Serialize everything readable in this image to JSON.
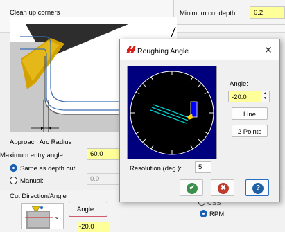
{
  "background_dialog": {
    "clean_up_corners_label": "Clean up corners",
    "minimum_cut_depth_label": "Minimum cut depth:",
    "minimum_cut_depth_value": "0.2",
    "approach_arc_title": "Approach Arc Radius",
    "max_entry_angle_label": "Maximum entry angle:",
    "max_entry_angle_value": "60.0",
    "same_as_depth_label": "Same as depth cut",
    "manual_label": "Manual:",
    "manual_value": "0.0",
    "cut_direction_title": "Cut Direction/Angle",
    "angle_button_label": "Angle...",
    "angle_value": "-20.0",
    "css_label": "CSS",
    "rpm_label": "RPM"
  },
  "roughing_angle_dialog": {
    "title": "Roughing Angle",
    "close_glyph": "✕",
    "angle_label": "Angle:",
    "angle_value": "-20.0",
    "line_button": "Line",
    "two_points_button": "2 Points",
    "resolution_label": "Resolution (deg.):",
    "resolution_value": "5",
    "ok_icon_glyph": "✔",
    "cancel_icon_glyph": "✖",
    "help_icon_glyph": "?"
  },
  "colors": {
    "input_highlight": "#ffff99",
    "dial_background": "#00007f",
    "dial_circle": "#000000",
    "tool_hatch": "#00d8d8",
    "tool_marker_blue": "#0000ff",
    "tool_marker_yellow": "#ffd400",
    "ok_green": "#3a8f4a",
    "cancel_red": "#c0392b",
    "help_blue": "#1f5fa5"
  }
}
